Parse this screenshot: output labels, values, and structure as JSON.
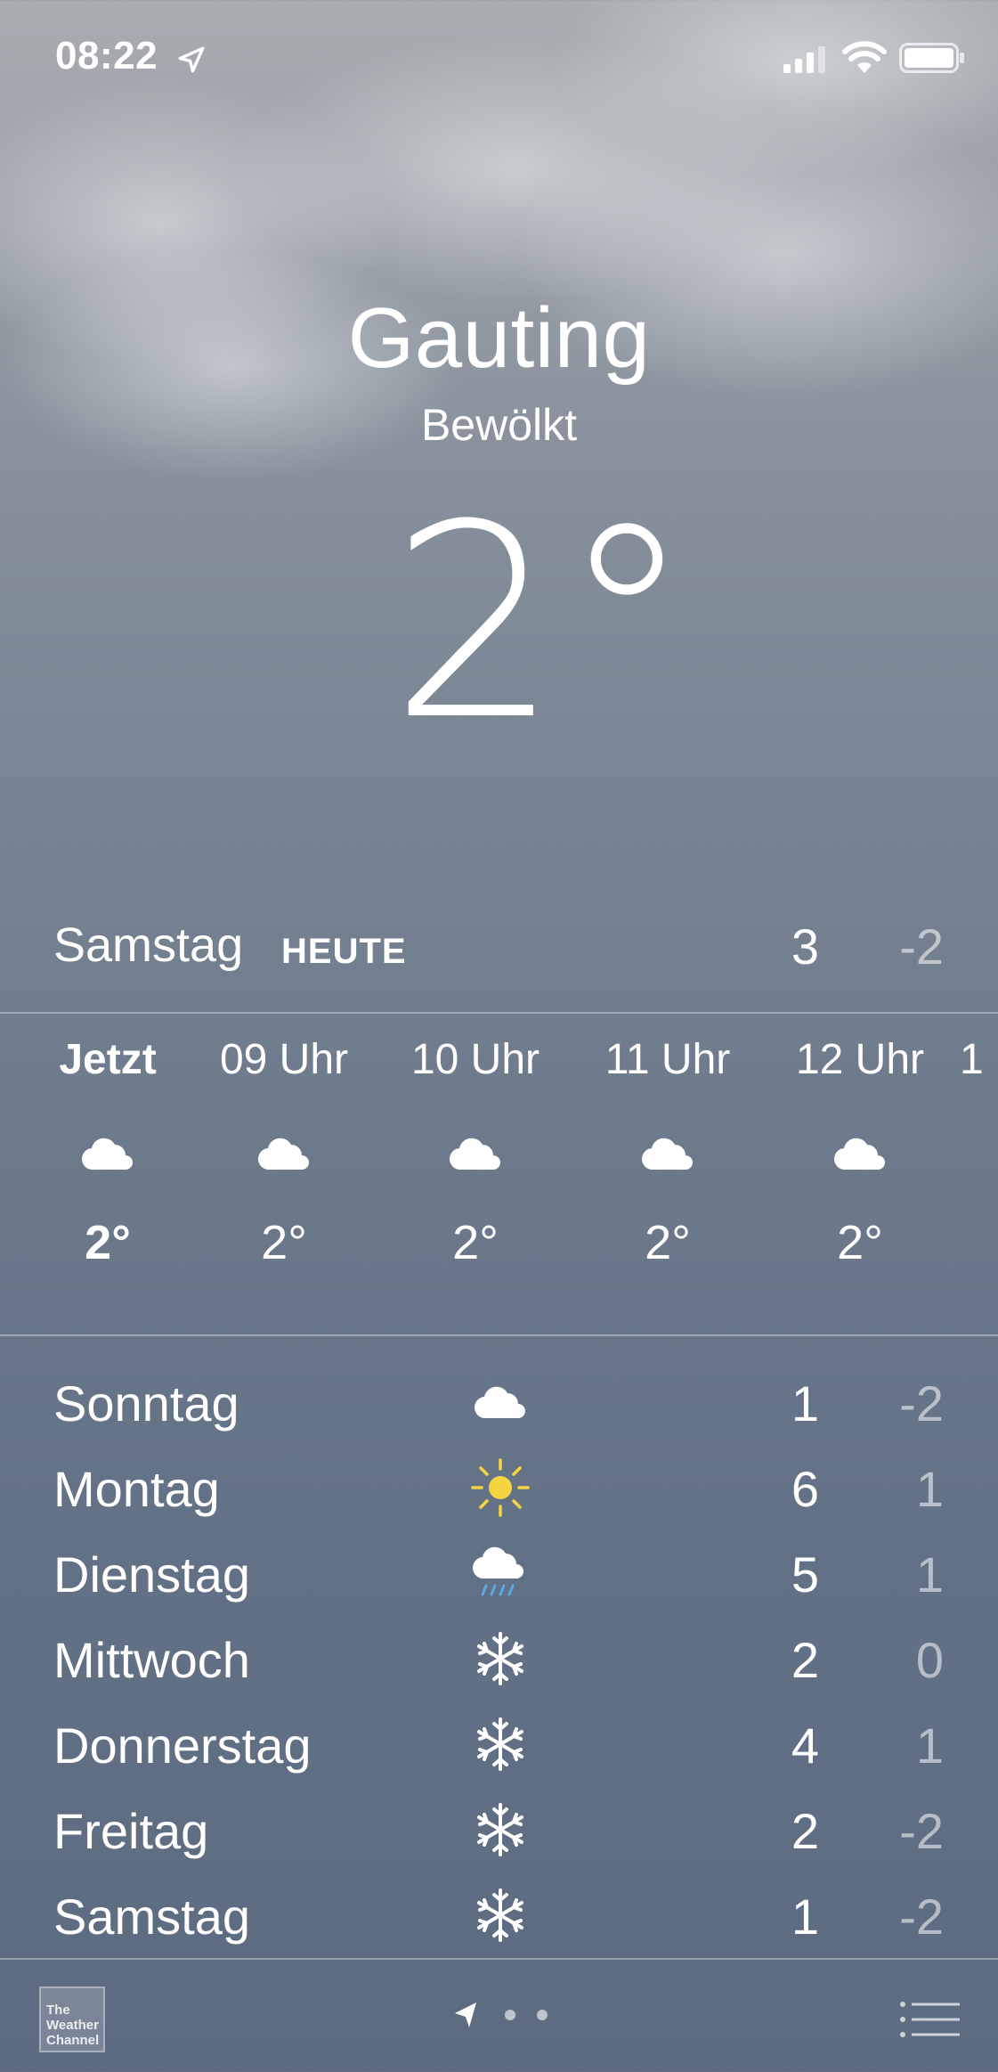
{
  "status_bar": {
    "time": "08:22",
    "icons": [
      "location-arrow-icon",
      "signal-icon",
      "wifi-icon",
      "battery-icon"
    ]
  },
  "header": {
    "city": "Gauting",
    "condition": "Bewölkt",
    "temperature": "2°"
  },
  "today": {
    "day": "Samstag",
    "tag": "HEUTE",
    "high": "3",
    "low": "-2"
  },
  "hourly": [
    {
      "label": "Jetzt",
      "icon": "cloud-icon",
      "temp": "2°"
    },
    {
      "label": "09 Uhr",
      "icon": "cloud-icon",
      "temp": "2°"
    },
    {
      "label": "10 Uhr",
      "icon": "cloud-icon",
      "temp": "2°"
    },
    {
      "label": "11 Uhr",
      "icon": "cloud-icon",
      "temp": "2°"
    },
    {
      "label": "12 Uhr",
      "icon": "cloud-icon",
      "temp": "2°"
    },
    {
      "label": "1",
      "icon": "",
      "temp": ""
    }
  ],
  "daily": [
    {
      "day": "Sonntag",
      "icon": "cloud-icon",
      "high": "1",
      "low": "-2"
    },
    {
      "day": "Montag",
      "icon": "sun-icon",
      "high": "6",
      "low": "1"
    },
    {
      "day": "Dienstag",
      "icon": "rain-cloud-icon",
      "high": "5",
      "low": "1"
    },
    {
      "day": "Mittwoch",
      "icon": "snowflake-icon",
      "high": "2",
      "low": "0"
    },
    {
      "day": "Donnerstag",
      "icon": "snowflake-icon",
      "high": "4",
      "low": "1"
    },
    {
      "day": "Freitag",
      "icon": "snowflake-icon",
      "high": "2",
      "low": "-2"
    },
    {
      "day": "Samstag",
      "icon": "snowflake-icon",
      "high": "1",
      "low": "-2"
    }
  ],
  "bottom_bar": {
    "logo_text": "The Weather Channel",
    "logo_line1": "The",
    "logo_line2": "Weather",
    "logo_line3": "Channel",
    "page_count": 3,
    "current_page": 1
  },
  "colors": {
    "sun": "#f5d442",
    "rain": "#5aa9e6",
    "text": "#ffffff"
  }
}
